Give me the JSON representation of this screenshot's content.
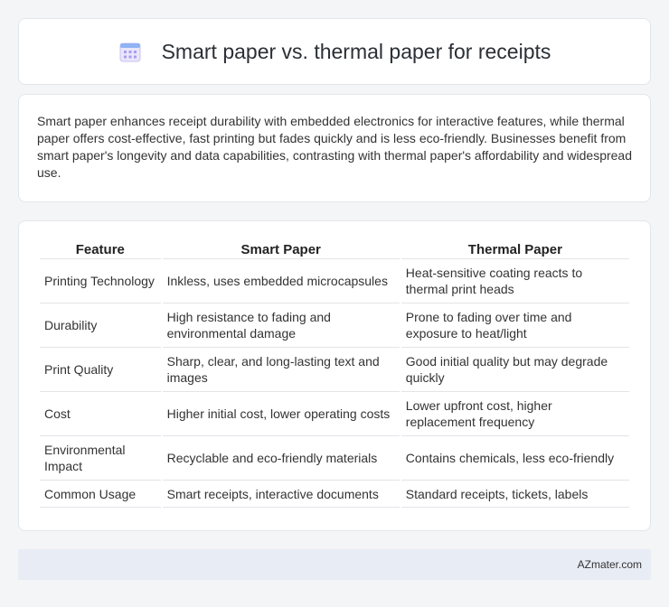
{
  "header": {
    "title": "Smart paper vs. thermal paper for receipts",
    "icon": "calendar-icon"
  },
  "summary": {
    "text": "Smart paper enhances receipt durability with embedded electronics for interactive features, while thermal paper offers cost-effective, fast printing but fades quickly and is less eco-friendly. Businesses benefit from smart paper's longevity and data capabilities, contrasting with thermal paper's affordability and widespread use."
  },
  "table": {
    "headers": [
      "Feature",
      "Smart Paper",
      "Thermal Paper"
    ],
    "rows": [
      [
        "Printing Technology",
        "Inkless, uses embedded microcapsules",
        "Heat-sensitive coating reacts to thermal print heads"
      ],
      [
        "Durability",
        "High resistance to fading and environmental damage",
        "Prone to fading over time and exposure to heat/light"
      ],
      [
        "Print Quality",
        "Sharp, clear, and long-lasting text and images",
        "Good initial quality but may degrade quickly"
      ],
      [
        "Cost",
        "Higher initial cost, lower operating costs",
        "Lower upfront cost, higher replacement frequency"
      ],
      [
        "Environmental Impact",
        "Recyclable and eco-friendly materials",
        "Contains chemicals, less eco-friendly"
      ],
      [
        "Common Usage",
        "Smart receipts, interactive documents",
        "Standard receipts, tickets, labels"
      ]
    ]
  },
  "footer": {
    "text": "AZmater.com"
  }
}
